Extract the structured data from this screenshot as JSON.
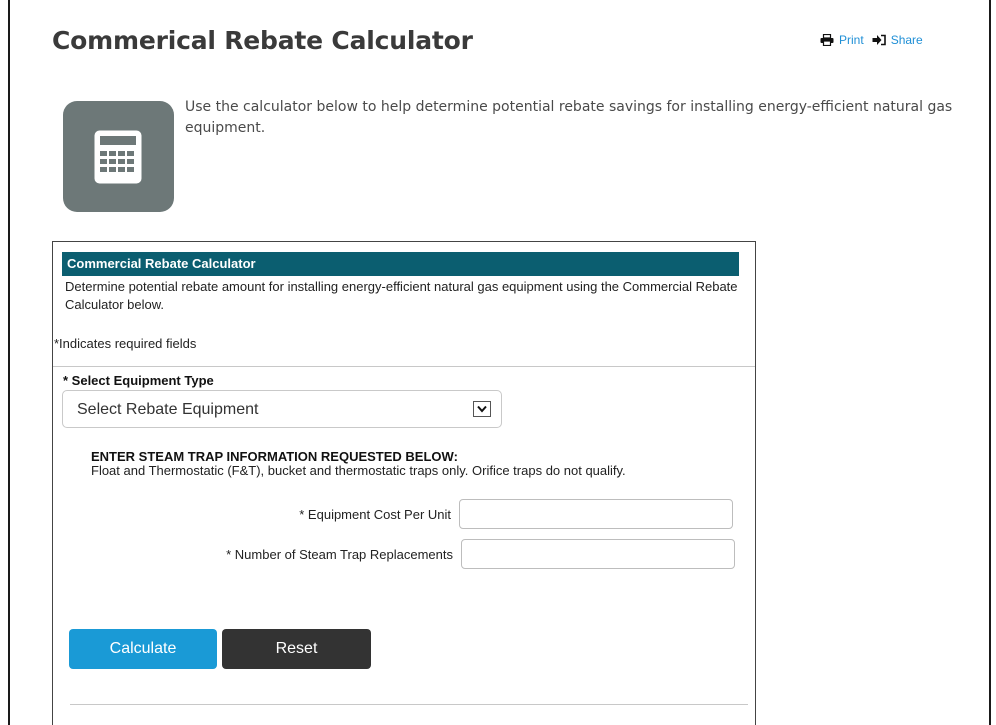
{
  "page": {
    "title": "Commerical Rebate Calculator",
    "intro": "Use the calculator below to help determine potential rebate savings for installing energy-efficient natural gas equipment."
  },
  "tools": {
    "print_label": "Print",
    "share_label": "Share"
  },
  "calculator": {
    "header": "Commercial Rebate Calculator",
    "description": "Determine potential rebate amount for installing energy-efficient natural gas equipment using the Commercial Rebate Calculator below.",
    "required_note": "*Indicates required fields",
    "equipment": {
      "label": "* Select Equipment Type",
      "selected": "Select Rebate Equipment"
    },
    "steam_trap": {
      "title": "ENTER STEAM TRAP INFORMATION REQUESTED BELOW:",
      "note": "Float and Thermostatic (F&T), bucket and thermostatic traps only. Orifice traps do not qualify."
    },
    "fields": {
      "cost_label": "* Equipment Cost Per Unit",
      "cost_value": "",
      "count_label": "* Number of Steam Trap Replacements",
      "count_value": ""
    },
    "buttons": {
      "calculate": "Calculate",
      "reset": "Reset"
    }
  },
  "colors": {
    "header_bg": "#0b5e70",
    "accent_link": "#1f8fd6",
    "calculate_bg": "#1a9ad6",
    "reset_bg": "#333333",
    "icon_tile": "#6d7878"
  }
}
